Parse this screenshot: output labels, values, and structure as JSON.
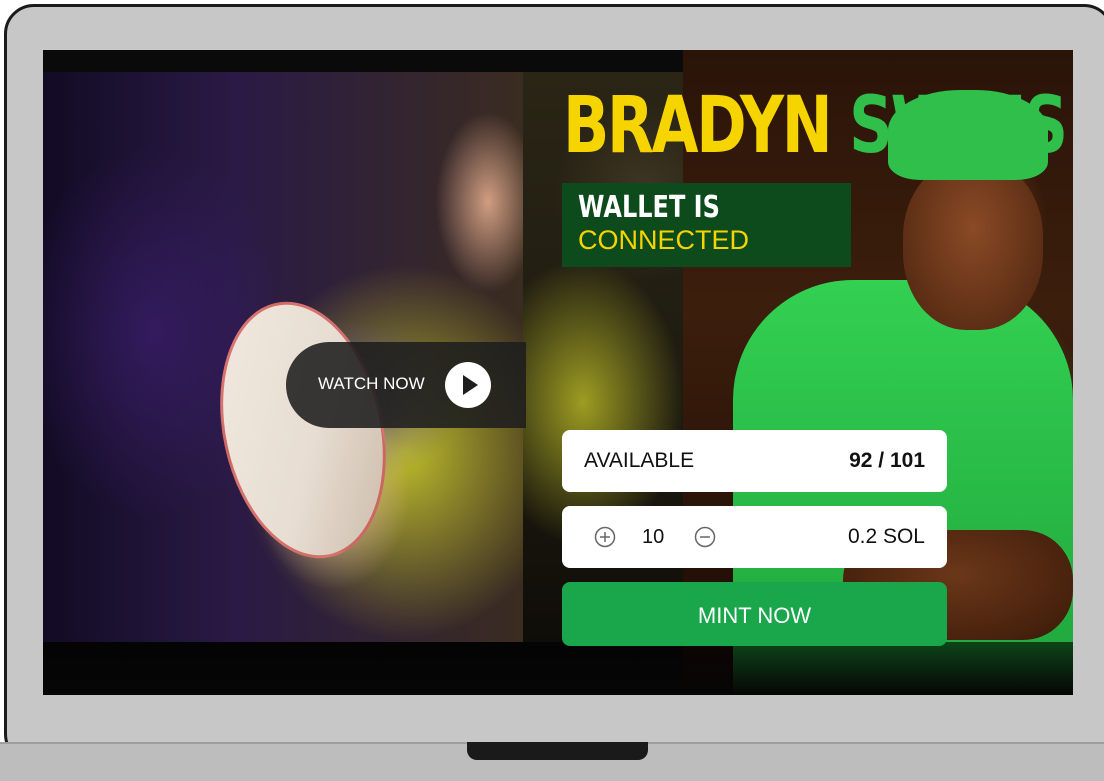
{
  "hero": {
    "headline_first": "BRADYN",
    "headline_last": "SWINS"
  },
  "watch": {
    "label": "WATCH NOW",
    "icon": "play-icon"
  },
  "wallet": {
    "line1": "WALLET IS",
    "line2": "CONNECTED"
  },
  "mint": {
    "available_label": "AVAILABLE",
    "available_value": "92 / 101",
    "quantity": "10",
    "price": "0.2 SOL",
    "plus_icon": "plus-circle-icon",
    "minus_icon": "minus-circle-icon",
    "button_label": "MINT NOW"
  },
  "colors": {
    "headline_yellow": "#f5d400",
    "headline_green": "#2fbf4a",
    "wallet_bg": "#0d4b1c",
    "mint_green": "#1aa64b"
  }
}
